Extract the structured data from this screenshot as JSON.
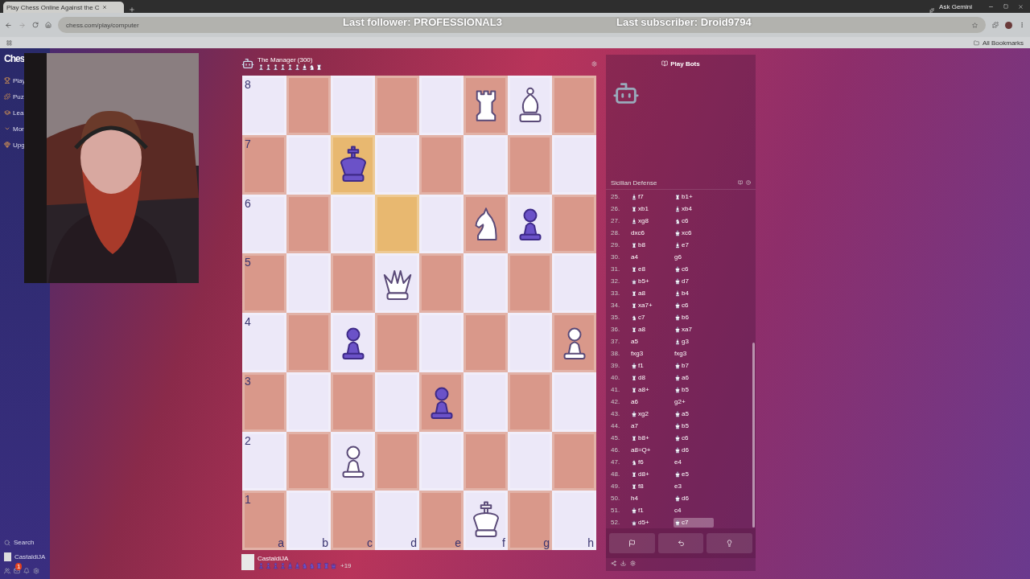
{
  "browser": {
    "tab_title": "Play Chess Online Against the C",
    "url": "chess.com/play/computer",
    "ask": "Ask Gemini",
    "bookmarks": "All Bookmarks"
  },
  "overlay": {
    "follower": "Last follower: PROFESSIONAL3",
    "subscriber": "Last subscriber: Droid9794"
  },
  "sidebar": {
    "logo": "Ches",
    "items": [
      {
        "label": "Play"
      },
      {
        "label": "Puz"
      },
      {
        "label": "Lea"
      },
      {
        "label": "Mor"
      },
      {
        "label": "Upg"
      }
    ],
    "search": "Search",
    "user": "CastaldiJA",
    "badge": "1"
  },
  "opponent": {
    "name": "The Manager (300)",
    "captured": [
      {
        "kind": "pawn"
      },
      {
        "kind": "pawn"
      },
      {
        "kind": "pawn"
      },
      {
        "kind": "pawn"
      },
      {
        "kind": "pawn"
      },
      {
        "kind": "pawn"
      },
      {
        "kind": "bishop"
      },
      {
        "kind": "knight"
      },
      {
        "kind": "rook"
      }
    ]
  },
  "board": {
    "files": [
      "a",
      "b",
      "c",
      "d",
      "e",
      "f",
      "g",
      "h"
    ],
    "rows": [
      {
        "rank": "8",
        "squares": [
          {
            "highlighted": false
          },
          {
            "highlighted": false
          },
          {
            "highlighted": false
          },
          {
            "highlighted": false
          },
          {
            "highlighted": false
          },
          {
            "highlighted": false,
            "kind": "rook",
            "black": false
          },
          {
            "highlighted": false,
            "kind": "bishop",
            "black": false
          },
          {
            "highlighted": false
          }
        ]
      },
      {
        "rank": "7",
        "squares": [
          {
            "highlighted": false
          },
          {
            "highlighted": false
          },
          {
            "highlighted": true,
            "kind": "king",
            "black": true
          },
          {
            "highlighted": false
          },
          {
            "highlighted": false
          },
          {
            "highlighted": false
          },
          {
            "highlighted": false
          },
          {
            "highlighted": false
          }
        ]
      },
      {
        "rank": "6",
        "squares": [
          {
            "highlighted": false
          },
          {
            "highlighted": false
          },
          {
            "highlighted": false
          },
          {
            "highlighted": true
          },
          {
            "highlighted": false
          },
          {
            "highlighted": false,
            "kind": "knight",
            "black": false
          },
          {
            "highlighted": false,
            "kind": "pawn",
            "black": true
          },
          {
            "highlighted": false
          }
        ]
      },
      {
        "rank": "5",
        "squares": [
          {
            "highlighted": false
          },
          {
            "highlighted": false
          },
          {
            "highlighted": false
          },
          {
            "highlighted": false,
            "kind": "queen",
            "black": false
          },
          {
            "highlighted": false
          },
          {
            "highlighted": false
          },
          {
            "highlighted": false
          },
          {
            "highlighted": false
          }
        ]
      },
      {
        "rank": "4",
        "squares": [
          {
            "highlighted": false
          },
          {
            "highlighted": false
          },
          {
            "highlighted": false,
            "kind": "pawn",
            "black": true
          },
          {
            "highlighted": false
          },
          {
            "highlighted": false
          },
          {
            "highlighted": false
          },
          {
            "highlighted": false
          },
          {
            "highlighted": false,
            "kind": "pawn",
            "black": false
          }
        ]
      },
      {
        "rank": "3",
        "squares": [
          {
            "highlighted": false
          },
          {
            "highlighted": false
          },
          {
            "highlighted": false
          },
          {
            "highlighted": false
          },
          {
            "highlighted": false,
            "kind": "pawn",
            "black": true
          },
          {
            "highlighted": false
          },
          {
            "highlighted": false
          },
          {
            "highlighted": false
          }
        ]
      },
      {
        "rank": "2",
        "squares": [
          {
            "highlighted": false
          },
          {
            "highlighted": false
          },
          {
            "highlighted": false,
            "kind": "pawn",
            "black": false
          },
          {
            "highlighted": false
          },
          {
            "highlighted": false
          },
          {
            "highlighted": false
          },
          {
            "highlighted": false
          },
          {
            "highlighted": false
          }
        ]
      },
      {
        "rank": "1",
        "squares": [
          {
            "highlighted": false
          },
          {
            "highlighted": false
          },
          {
            "highlighted": false
          },
          {
            "highlighted": false
          },
          {
            "highlighted": false
          },
          {
            "highlighted": false,
            "kind": "king",
            "black": false
          },
          {
            "highlighted": false
          },
          {
            "highlighted": false
          }
        ]
      }
    ]
  },
  "player": {
    "name": "CastaldiJA",
    "captured": [
      {
        "kind": "pawn"
      },
      {
        "kind": "pawn"
      },
      {
        "kind": "pawn"
      },
      {
        "kind": "pawn"
      },
      {
        "kind": "bishop"
      },
      {
        "kind": "bishop"
      },
      {
        "kind": "knight"
      },
      {
        "kind": "knight"
      },
      {
        "kind": "rook"
      },
      {
        "kind": "rook"
      },
      {
        "kind": "queen"
      }
    ],
    "advantage": "+19"
  },
  "panel": {
    "title": "Play Bots",
    "opening": "Sicilian Defense",
    "moves": [
      {
        "number": "25.",
        "white": {
          "kind": "bishop",
          "text": "f7",
          "selected": false
        },
        "black": {
          "kind": "rook",
          "text": "b1+",
          "selected": false
        }
      },
      {
        "number": "26.",
        "white": {
          "kind": "rook",
          "text": "xb1",
          "selected": false
        },
        "black": {
          "kind": "bishop",
          "text": "xb4",
          "selected": false
        }
      },
      {
        "number": "27.",
        "white": {
          "kind": "bishop",
          "text": "xg8",
          "selected": false
        },
        "black": {
          "kind": "knight",
          "text": "c6",
          "selected": false
        }
      },
      {
        "number": "28.",
        "white": {
          "text": "dxc6",
          "selected": false
        },
        "black": {
          "kind": "king",
          "text": "xc6",
          "selected": false
        }
      },
      {
        "number": "29.",
        "white": {
          "kind": "rook",
          "text": "b8",
          "selected": false
        },
        "black": {
          "kind": "bishop",
          "text": "e7",
          "selected": false
        }
      },
      {
        "number": "30.",
        "white": {
          "text": "a4",
          "selected": false
        },
        "black": {
          "text": "g6",
          "selected": false
        }
      },
      {
        "number": "31.",
        "white": {
          "kind": "rook",
          "text": "e8",
          "selected": false
        },
        "black": {
          "kind": "king",
          "text": "c6",
          "selected": false
        }
      },
      {
        "number": "32.",
        "white": {
          "kind": "queen",
          "text": "b5+",
          "selected": false
        },
        "black": {
          "kind": "king",
          "text": "d7",
          "selected": false
        }
      },
      {
        "number": "33.",
        "white": {
          "kind": "rook",
          "text": "a8",
          "selected": false
        },
        "black": {
          "kind": "bishop",
          "text": "b4",
          "selected": false
        }
      },
      {
        "number": "34.",
        "white": {
          "kind": "rook",
          "text": "xa7+",
          "selected": false
        },
        "black": {
          "kind": "king",
          "text": "c6",
          "selected": false
        }
      },
      {
        "number": "35.",
        "white": {
          "kind": "knight",
          "text": "c7",
          "selected": false
        },
        "black": {
          "kind": "king",
          "text": "b6",
          "selected": false
        }
      },
      {
        "number": "36.",
        "white": {
          "kind": "rook",
          "text": "a8",
          "selected": false
        },
        "black": {
          "kind": "king",
          "text": "xa7",
          "selected": false
        }
      },
      {
        "number": "37.",
        "white": {
          "text": "a5",
          "selected": false
        },
        "black": {
          "kind": "bishop",
          "text": "g3",
          "selected": false
        }
      },
      {
        "number": "38.",
        "white": {
          "text": "fxg3",
          "selected": false
        },
        "black": {
          "text": "fxg3",
          "selected": false
        }
      },
      {
        "number": "39.",
        "white": {
          "kind": "king",
          "text": "f1",
          "selected": false
        },
        "black": {
          "kind": "king",
          "text": "b7",
          "selected": false
        }
      },
      {
        "number": "40.",
        "white": {
          "kind": "rook",
          "text": "d8",
          "selected": false
        },
        "black": {
          "kind": "king",
          "text": "a6",
          "selected": false
        }
      },
      {
        "number": "41.",
        "white": {
          "kind": "rook",
          "text": "a8+",
          "selected": false
        },
        "black": {
          "kind": "king",
          "text": "b5",
          "selected": false
        }
      },
      {
        "number": "42.",
        "white": {
          "text": "a6",
          "selected": false
        },
        "black": {
          "text": "g2+",
          "selected": false
        }
      },
      {
        "number": "43.",
        "white": {
          "kind": "king",
          "text": "xg2",
          "selected": false
        },
        "black": {
          "kind": "king",
          "text": "a5",
          "selected": false
        }
      },
      {
        "number": "44.",
        "white": {
          "text": "a7",
          "selected": false
        },
        "black": {
          "kind": "king",
          "text": "b5",
          "selected": false
        }
      },
      {
        "number": "45.",
        "white": {
          "kind": "rook",
          "text": "b8+",
          "selected": false
        },
        "black": {
          "kind": "king",
          "text": "c6",
          "selected": false
        }
      },
      {
        "number": "46.",
        "white": {
          "text": "a8=Q+",
          "selected": false
        },
        "black": {
          "kind": "king",
          "text": "d6",
          "selected": false
        }
      },
      {
        "number": "47.",
        "white": {
          "kind": "knight",
          "text": "f6",
          "selected": false
        },
        "black": {
          "text": "e4",
          "selected": false
        }
      },
      {
        "number": "48.",
        "white": {
          "kind": "rook",
          "text": "d8+",
          "selected": false
        },
        "black": {
          "kind": "king",
          "text": "e5",
          "selected": false
        }
      },
      {
        "number": "49.",
        "white": {
          "kind": "rook",
          "text": "f8",
          "selected": false
        },
        "black": {
          "text": "e3",
          "selected": false
        }
      },
      {
        "number": "50.",
        "white": {
          "text": "h4",
          "selected": false
        },
        "black": {
          "kind": "king",
          "text": "d6",
          "selected": false
        }
      },
      {
        "number": "51.",
        "white": {
          "kind": "king",
          "text": "f1",
          "selected": false
        },
        "black": {
          "text": "c4",
          "selected": false
        }
      },
      {
        "number": "52.",
        "white": {
          "kind": "queen",
          "text": "d5+",
          "selected": false
        },
        "black": {
          "kind": "king",
          "text": "c7",
          "selected": true
        }
      }
    ]
  }
}
